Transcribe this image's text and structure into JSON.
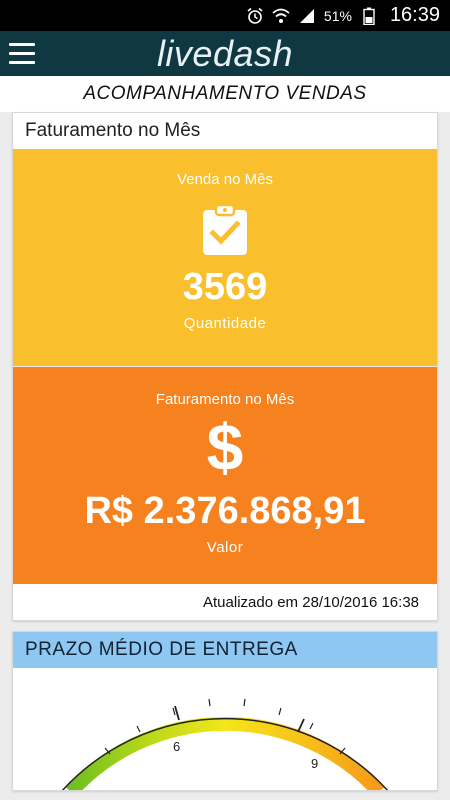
{
  "status_bar": {
    "battery": "51%",
    "time": "16:39",
    "icons": [
      "alarm-icon",
      "wifi-icon",
      "signal-icon",
      "battery-icon"
    ]
  },
  "app_bar": {
    "logo_part1": "live",
    "logo_part2": "dash"
  },
  "page": {
    "title": "ACOMPANHAMENTO VENDAS"
  },
  "billing_card": {
    "header": "Faturamento no Mês",
    "sales_tile": {
      "title": "Venda no Mês",
      "icon": "clipboard-check-icon",
      "value": "3569",
      "subtitle": "Quantidade",
      "color": "#f9bf2c"
    },
    "revenue_tile": {
      "title": "Faturamento no Mês",
      "icon": "dollar-icon",
      "symbol": "$",
      "value": "R$ 2.376.868,91",
      "subtitle": "Valor",
      "color": "#f5811f"
    },
    "updated": "Atualizado em 28/10/2016 16:38"
  },
  "delivery_card": {
    "header": "PRAZO MÉDIO DE ENTREGA",
    "header_color": "#8ec7f1",
    "gauge_labels": [
      "6",
      "9"
    ]
  }
}
